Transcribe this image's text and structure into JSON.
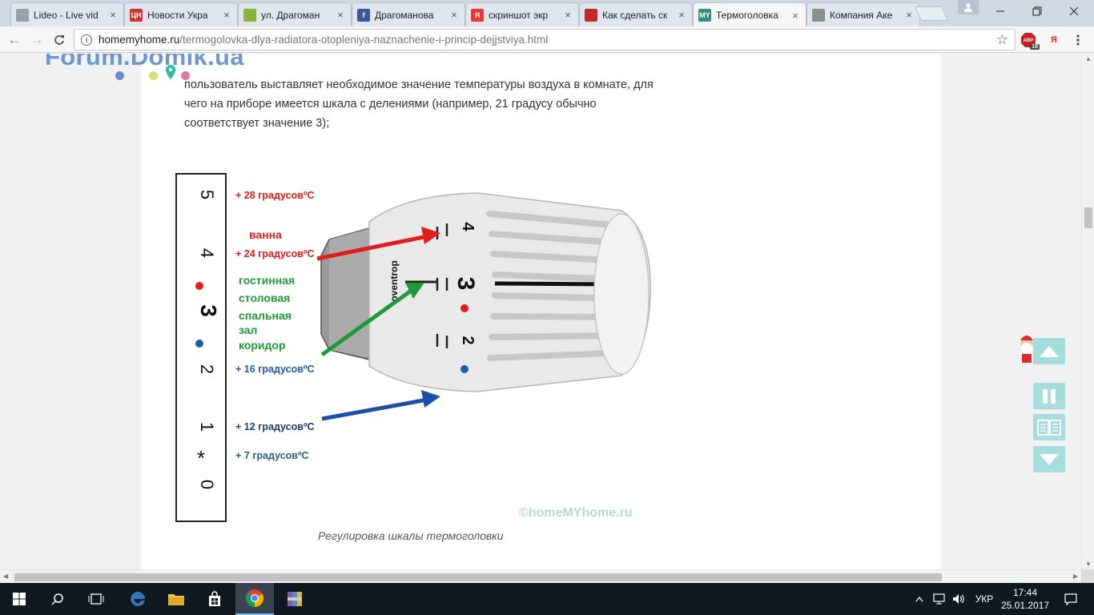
{
  "browser": {
    "tabs": [
      {
        "title": "Lideo - Live vid",
        "favicon": "doc-icon",
        "color": "#9aa0a6",
        "glyph": ""
      },
      {
        "title": "Новости Укра",
        "favicon": "tsn-icon",
        "color": "#d23030",
        "glyph": "ЦН"
      },
      {
        "title": "ул. Драгоман",
        "favicon": "map-icon",
        "color": "#8bb33a",
        "glyph": ""
      },
      {
        "title": "Драгоманова",
        "favicon": "facebook-icon",
        "color": "#3b5998",
        "glyph": "f"
      },
      {
        "title": "скриншот экр",
        "favicon": "yandex-icon",
        "color": "#e33",
        "glyph": "Я"
      },
      {
        "title": "Как сделать ск",
        "favicon": "pdf-icon",
        "color": "#c62828",
        "glyph": ""
      },
      {
        "title": "Термоголовка",
        "favicon": "homemyhome-icon",
        "color": "#2f8f7a",
        "glyph": "MY"
      },
      {
        "title": "Компания Аке",
        "favicon": "page-icon",
        "color": "#8d8d8d",
        "glyph": ""
      }
    ],
    "address": {
      "host": "homemyhome.ru",
      "path": "/termogolovka-dlya-radiatora-otopleniya-naznachenie-i-princip-dejjstviya.html"
    },
    "extensions": {
      "abp_badge": "18",
      "yandex_label": "Я"
    }
  },
  "watermark": {
    "title": "Forum.Domik.ua",
    "dot_colors": [
      "#6b8ccc",
      "#d6df70",
      "#e07ba2"
    ],
    "pin_color": "#2fb9a0"
  },
  "article": {
    "paragraph": "пользователь выставляет необходимое значение температуры воздуха в комнате, для чего на приборе имеется шкала с делениями (например, 21 градусу обычно соответствует значение 3);",
    "caption": "Регулировка шкалы термоголовки"
  },
  "figure": {
    "scale_marks": [
      "5",
      "4",
      "3",
      "2",
      "1",
      "*",
      "0"
    ],
    "red_dot": "#e31b1b",
    "blue_dot": "#1f5aa5",
    "labels": {
      "t28": "+ 28 градусовºС",
      "vanna": "ванна",
      "t24": "+ 24 градусовºС",
      "gostinnaya": "гостинная",
      "stolovaya": "столовая",
      "spalnaya": "спальная",
      "zal": "зал",
      "koridor": "коридор",
      "t16": "+ 16 градусовºС",
      "t12": "+ 12 градусовºС",
      "t7": "+ 7 градусовºС"
    },
    "knob_numbers": [
      "4",
      "3",
      "2"
    ],
    "brand": "oventrop",
    "copyright": "©homeMYhome.ru"
  },
  "taskbar": {
    "language": "УКР",
    "time": "17:44",
    "date": "25.01.2017"
  }
}
